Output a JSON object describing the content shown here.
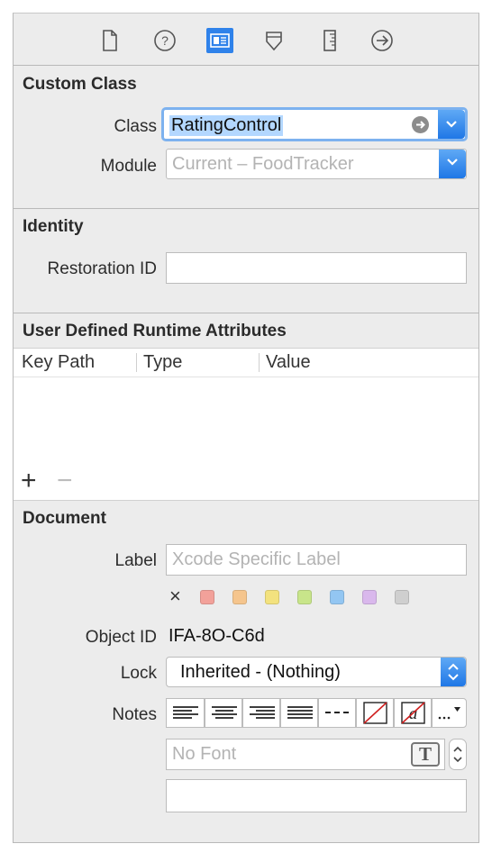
{
  "toolbar": {
    "icons": [
      "file-inspector-icon",
      "quick-help-icon",
      "identity-inspector-icon",
      "attributes-inspector-icon",
      "size-inspector-icon",
      "connections-inspector-icon"
    ]
  },
  "custom_class": {
    "title": "Custom Class",
    "class_label": "Class",
    "class_value": "RatingControl",
    "module_label": "Module",
    "module_value": "Current – FoodTracker"
  },
  "identity": {
    "title": "Identity",
    "restoration_label": "Restoration ID",
    "restoration_value": ""
  },
  "runtime_attributes": {
    "title": "User Defined Runtime Attributes",
    "columns": [
      "Key Path",
      "Type",
      "Value"
    ],
    "add": "+",
    "remove": "−"
  },
  "document": {
    "title": "Document",
    "label_label": "Label",
    "label_placeholder": "Xcode Specific Label",
    "clear_glyph": "×",
    "swatches": [
      "#f2a19a",
      "#f5c58d",
      "#f3e27e",
      "#c8e58a",
      "#93c6f2",
      "#d9b8ec",
      "#cfcfcf"
    ],
    "object_id_label": "Object ID",
    "object_id_value": "IFA-8O-C6d",
    "lock_label": "Lock",
    "lock_value": "Inherited - (Nothing)",
    "notes_label": "Notes",
    "font_placeholder": "No Font",
    "font_icon": "T",
    "notes_value": ""
  },
  "colors": {
    "accent": "#2f82ea",
    "selection": "#b3d7ff"
  }
}
